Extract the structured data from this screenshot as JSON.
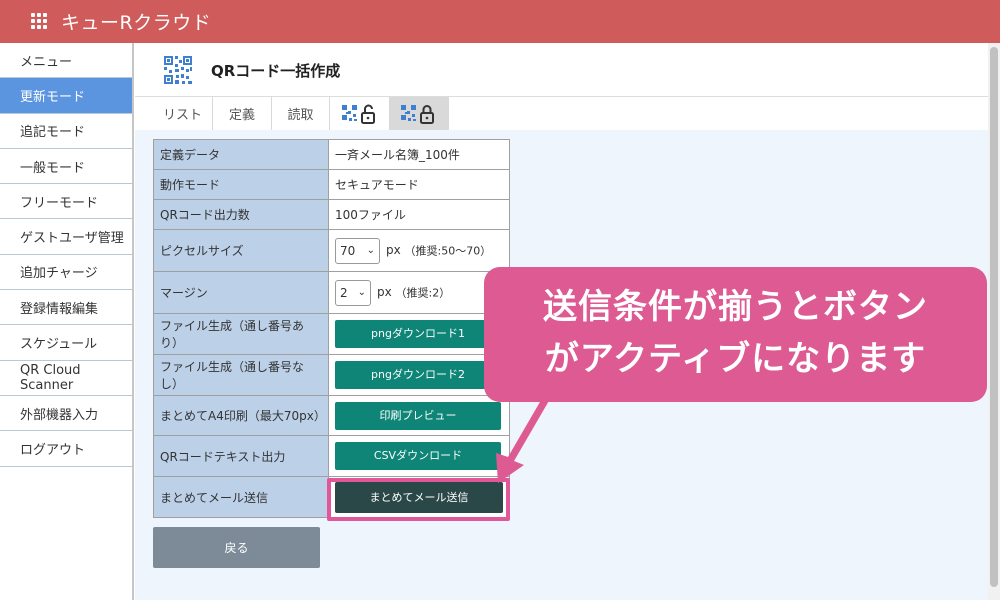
{
  "header": {
    "title": "キューRクラウド"
  },
  "sidebar": {
    "items": [
      {
        "label": "メニュー"
      },
      {
        "label": "更新モード"
      },
      {
        "label": "追記モード"
      },
      {
        "label": "一般モード"
      },
      {
        "label": "フリーモード"
      },
      {
        "label": "ゲストユーザ管理"
      },
      {
        "label": "追加チャージ"
      },
      {
        "label": "登録情報編集"
      },
      {
        "label": "スケジュール"
      },
      {
        "label": "QR Cloud Scanner"
      },
      {
        "label": "外部機器入力"
      },
      {
        "label": "ログアウト"
      }
    ],
    "active_index": 1
  },
  "page": {
    "title": "QRコード一括作成"
  },
  "tabs": [
    {
      "label": "リスト"
    },
    {
      "label": "定義"
    },
    {
      "label": "読取"
    },
    {
      "label": "",
      "icon": "qr-unlock-icon"
    },
    {
      "label": "",
      "icon": "qr-lock-icon"
    }
  ],
  "form": {
    "definition_label": "定義データ",
    "definition_value": "一斉メール名簿_100件",
    "mode_label": "動作モード",
    "mode_value": "セキュアモード",
    "count_label": "QRコード出力数",
    "count_value": "100ファイル",
    "pixel_label": "ピクセルサイズ",
    "pixel_value": "70",
    "pixel_unit": "px",
    "pixel_hint": "（推奨:50〜70）",
    "margin_label": "マージン",
    "margin_value": "2",
    "margin_unit": "px",
    "margin_hint": "（推奨:2）",
    "file_seq_label": "ファイル生成（通し番号あり）",
    "file_seq_button": "pngダウンロード1",
    "file_noseq_label": "ファイル生成（通し番号なし）",
    "file_noseq_button": "pngダウンロード2",
    "print_label": "まとめてA4印刷（最大70px）",
    "print_button": "印刷プレビュー",
    "text_label": "QRコードテキスト出力",
    "text_button": "CSVダウンロード",
    "mail_label": "まとめてメール送信",
    "mail_button": "まとめてメール送信"
  },
  "back_button": "戻る",
  "callout": {
    "line1": "送信条件が揃うとボタン",
    "line2": "がアクティブになります"
  },
  "colors": {
    "header": "#cf5b5b",
    "sidebar_active": "#5b95e0",
    "teal_button": "#0e8577",
    "active_button": "#2b4848",
    "callout": "#dd5a93",
    "label_cell": "#bcd0e8",
    "warning_text": "#e52222"
  }
}
